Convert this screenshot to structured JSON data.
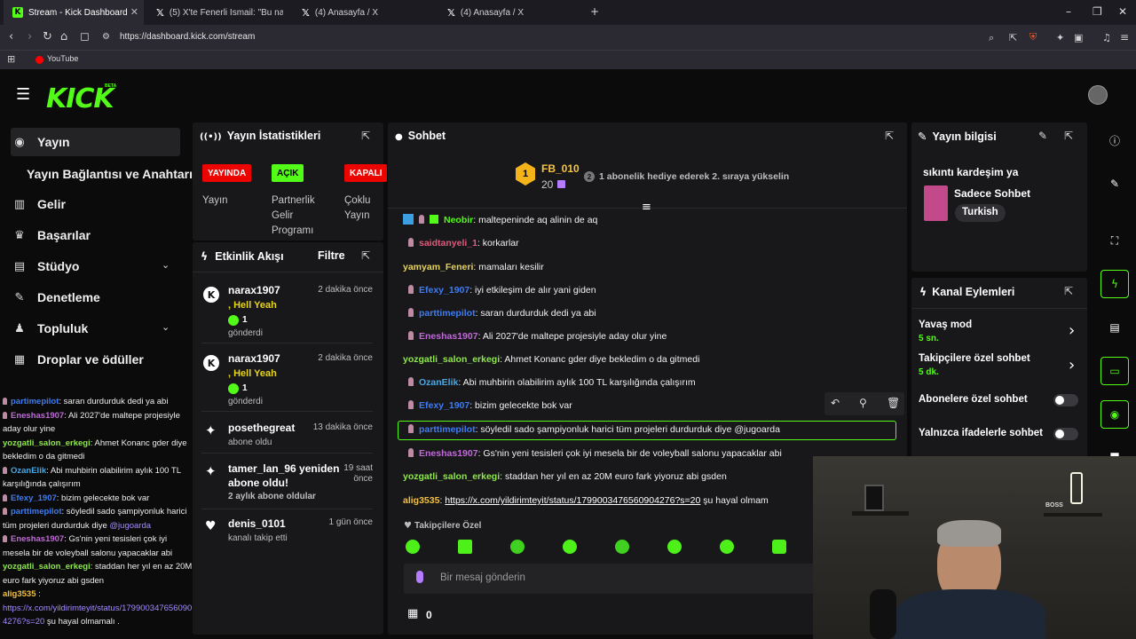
{
  "browser": {
    "tabs": [
      {
        "label": "Stream - Kick Dashboard"
      },
      {
        "label": "(5) X'te Fenerli İsmail: \"Bu nasıl uçak"
      },
      {
        "label": "(4) Anasayfa / X"
      },
      {
        "label": "(4) Anasayfa / X"
      }
    ],
    "url": "https://dashboard.kick.com/stream",
    "bookmark": "YouTube"
  },
  "logo": {
    "text": "KICK",
    "beta": "BETA"
  },
  "sidebar": {
    "items": [
      {
        "label": "Yayın"
      },
      {
        "label": "Yayın Bağlantısı ve Anahtarı"
      },
      {
        "label": "Gelir"
      },
      {
        "label": "Başarılar"
      },
      {
        "label": "Stüdyo"
      },
      {
        "label": "Denetleme"
      },
      {
        "label": "Topluluk"
      },
      {
        "label": "Droplar ve ödüller"
      }
    ],
    "chat": [
      {
        "user": "partimepilot",
        "msg": ": saran durdurduk dedi ya abi",
        "color": "#3f7cf0"
      },
      {
        "user": "Eneshas1907",
        "msg": ": Ali 2027'de maltepe projesiyle aday olur yine",
        "color": "#c06ad8"
      },
      {
        "user": "yozgatli_salon_erkegi",
        "msg": ": Ahmet Konanc gder diye bekledim o da gitmedi",
        "color": "#8ee84a"
      },
      {
        "user": "OzanElik",
        "msg": ": Abi muhbirin olabilirim aylık 100 TL karşılığında çalışırım",
        "color": "#4aa7e0"
      },
      {
        "user": "Efexy_1907",
        "msg": ": bizim gelecekte bok var",
        "color": "#3f7cf0"
      },
      {
        "user": "parttimepilot",
        "msg": ": söyledil sado şampiyonluk harici tüm projeleri durdurduk diye ",
        "mention": "@jugoarda",
        "color": "#3f7cf0"
      },
      {
        "user": "Eneshas1907",
        "msg": ": Gs'nin yeni tesisleri çok iyi mesela bir de voleyball salonu yapacaklar abi",
        "color": "#c06ad8"
      },
      {
        "user": "yozgatli_salon_erkegi",
        "msg": ": staddan her yıl en az 20M euro fark yiyoruz abi gsden",
        "color": "#8ee84a"
      },
      {
        "user": "alig3535",
        "msg": " :",
        "link": "https://x.com/yildirimteyit/status/1799003476560904276?s=20",
        "tail": " şu hayal olmamalı .",
        "color": "#f0c040"
      }
    ]
  },
  "stats": {
    "title": "Yayın İstatistikleri",
    "badges": [
      {
        "label": "YAYINDA",
        "sub": "Yayın"
      },
      {
        "label": "AÇIK",
        "sub": "Partnerlik Gelir Programı"
      },
      {
        "label": "KAPALI",
        "sub": "Çoklu Yayın"
      }
    ],
    "colors": {
      "live": "#eb0400",
      "on": "#53fc18"
    }
  },
  "activity": {
    "title": "Etkinlik Akışı",
    "filter": "Filtre",
    "events": [
      {
        "name": "narax1907",
        "detail": ", Hell Yeah",
        "count": "1",
        "action": "gönderdi",
        "time": "2 dakika önce"
      },
      {
        "name": "narax1907",
        "detail": ", Hell Yeah",
        "count": "1",
        "action": "gönderdi",
        "time": "2 dakika önce"
      },
      {
        "name": "posethegreat",
        "action": "abone oldu",
        "time": "13 dakika önce"
      },
      {
        "name": "tamer_lan_96 yeniden abone oldu!",
        "action": "2 aylık abone oldular",
        "time": "19 saat önce"
      },
      {
        "name": "denis_0101",
        "action": "kanalı takip etti",
        "time": "1 gün önce"
      }
    ]
  },
  "chat": {
    "title": "Sohbet",
    "top_user": "FB_010",
    "rank": "1",
    "top_count": "20",
    "promo_num": "2",
    "promo": "1 abonelik hediye ederek 2. sıraya yükselin",
    "messages": [
      {
        "user": "Neobir",
        "msg": ": maltepeninde aq alinin de aq",
        "color": "#53fc18"
      },
      {
        "user": "saidtanyeli_1",
        "msg": ": korkarlar",
        "color": "#e05a7a"
      },
      {
        "user": "yamyam_Feneri",
        "msg": ": mamaları kesilir",
        "color": "#e6d45a"
      },
      {
        "user": "Efexy_1907",
        "msg": ": iyi etkileşim de alır yani giden",
        "color": "#3f7cf0"
      },
      {
        "user": "parttimepilot",
        "msg": ": saran durdurduk dedi ya abi",
        "color": "#3f7cf0"
      },
      {
        "user": "Eneshas1907",
        "msg": ": Ali 2027'de maltepe projesiyle aday olur yine",
        "color": "#c06ad8"
      },
      {
        "user": "yozgatli_salon_erkegi",
        "msg": ": Ahmet Konanc gder diye bekledim o da gitmedi",
        "color": "#8ee84a"
      },
      {
        "user": "OzanElik",
        "msg": ": Abi muhbirin olabilirim aylık 100 TL karşılığında çalışırım",
        "color": "#4aa7e0"
      },
      {
        "user": "Efexy_1907",
        "msg": ": bizim gelecekte bok var",
        "color": "#3f7cf0"
      },
      {
        "user": "parttimepilot",
        "msg": ": söyledil sado şampiyonluk harici tüm projeleri durdurduk diye @jugoarda",
        "color": "#3f7cf0"
      },
      {
        "user": "Eneshas1907",
        "msg": ": Gs'nin yeni tesisleri çok iyi mesela bir de voleyball salonu yapacaklar abi",
        "color": "#c06ad8"
      },
      {
        "user": "yozgatli_salon_erkegi",
        "msg": ": staddan her yıl en az 20M euro fark yiyoruz abi gsden",
        "color": "#8ee84a"
      },
      {
        "user": "alig3535",
        "msg": ": ",
        "link": "https://x.com/yildirimteyit/status/1799003476560904276?s=20",
        "tail": " şu hayal olmam",
        "color": "#f0c040"
      }
    ],
    "followers_only": "Takipçilere Özel",
    "input_placeholder": "Bir mesaj gönderin",
    "bottom_count": "0"
  },
  "info": {
    "title": "Yayın bilgisi",
    "stream_title": "sıkıntı kardeşim ya",
    "category": "Sadece Sohbet",
    "language": "Turkish"
  },
  "actions": {
    "title": "Kanal Eylemleri",
    "rows": [
      {
        "label": "Yavaş mod",
        "sub": "5 sn."
      },
      {
        "label": "Takipçilere özel sohbet",
        "sub": "5 dk."
      },
      {
        "label": "Abonelere özel sohbet"
      },
      {
        "label": "Yalnızca ifadelerle sohbet"
      }
    ]
  },
  "webcam": {
    "sign": "BOSS"
  }
}
